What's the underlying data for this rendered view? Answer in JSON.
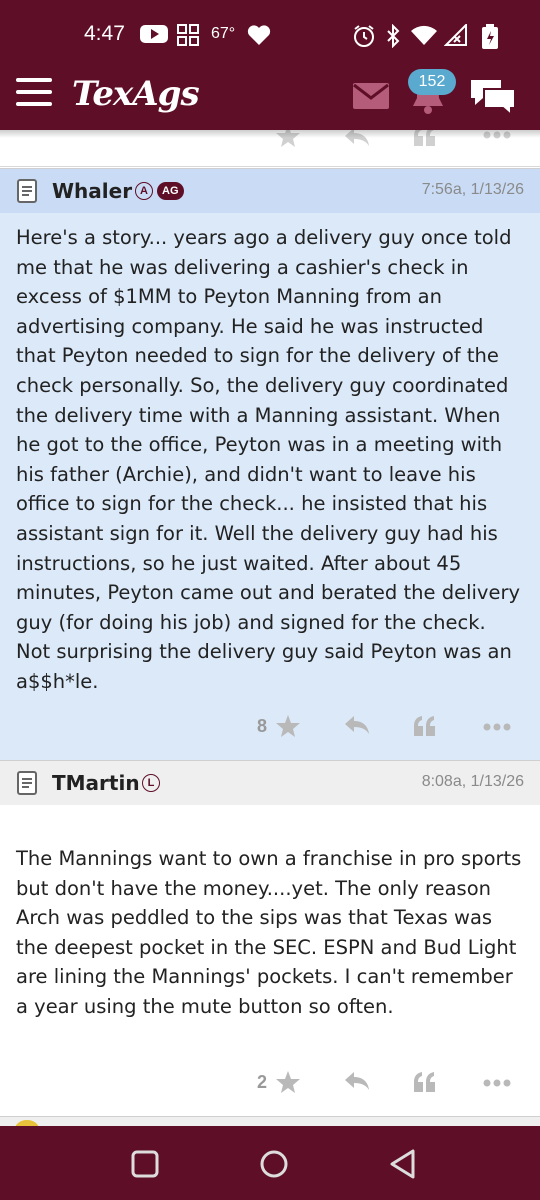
{
  "status": {
    "time": "4:47",
    "temp": "67°"
  },
  "header": {
    "logo": "TexAgs",
    "notification_count": "152"
  },
  "colors": {
    "brand": "#5e0f27",
    "highlight": "#dbe9f9",
    "badge": "#5aa9cf"
  },
  "posts": [
    {
      "user": "Whaler",
      "badges": [
        "A",
        "AG"
      ],
      "time": "7:56a, 1/13/26",
      "body": "Here's a story... years ago a delivery guy once told me that he was delivering a cashier's check in excess of $1MM to Peyton Manning from an advertising company. He said he was instructed that Peyton needed to sign for the delivery of the check personally. So, the delivery guy coordinated the delivery time with a Manning assistant. When he got to the office, Peyton was in a meeting with his father (Archie), and didn't want to leave his office to sign for the check... he insisted that his assistant sign for it. Well the delivery guy had his instructions, so he just waited. After about 45 minutes, Peyton came out and berated the delivery guy (for doing his job) and signed for the check. Not surprising the delivery guy said Peyton was an a$$h*le.",
      "stars": "8"
    },
    {
      "user": "TMartin",
      "badges": [
        "L"
      ],
      "time": "8:08a, 1/13/26",
      "body": "The Mannings want to own a franchise in pro sports but don't have the money....yet. The only reason Arch was peddled to the sips was that Texas was the deepest pocket in the SEC. ESPN and Bud Light are lining the Mannings' pockets. I can't remember a year using the mute button so often.",
      "stars": "2"
    }
  ]
}
